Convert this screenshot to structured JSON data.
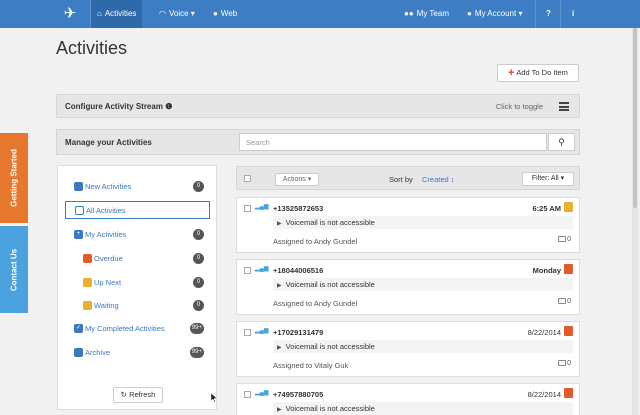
{
  "nav": {
    "activities": "Activities",
    "voice": "Voice",
    "web": "Web",
    "my_team": "My Team",
    "my_account": "My Account",
    "help": "?",
    "info": "i"
  },
  "side_tabs": {
    "getting_started": "Getting Started",
    "contact_us": "Contact Us"
  },
  "page": {
    "title": "Activities",
    "add_todo": "Add To Do Item",
    "configure_title": "Configure Activity Stream",
    "click_to_toggle": "Click to toggle",
    "manage_title": "Manage your Activities",
    "search_placeholder": "Search"
  },
  "filters": [
    {
      "label": "New Activities",
      "count": "0",
      "color": "#3a78c2"
    },
    {
      "label": "All Activities",
      "count": "",
      "color": "#3a78c2"
    },
    {
      "label": "My Activities",
      "count": "0",
      "color": "#3a78c2"
    },
    {
      "label": "Overdue",
      "count": "0",
      "color": "#e05a2a"
    },
    {
      "label": "Up Next",
      "count": "0",
      "color": "#e8b030"
    },
    {
      "label": "Waiting",
      "count": "0",
      "color": "#e8b030"
    },
    {
      "label": "My Completed Activities",
      "count": "99+",
      "color": "#3a78c2"
    },
    {
      "label": "Archive",
      "count": "99+",
      "color": "#3a78c2"
    }
  ],
  "refresh": "Refresh",
  "list": {
    "actions": "Actions",
    "sort_by": "Sort by",
    "sort_value": "Created",
    "filter": "Filter: All"
  },
  "activities": [
    {
      "phone": "+13525872653",
      "time": "6:25 AM",
      "message": "Voicemail is not accessible",
      "assigned": "Assigned to Andy Gundel",
      "comments": "0",
      "icon_color": "#e8b030",
      "bold_time": true
    },
    {
      "phone": "+18044006516",
      "time": "Monday",
      "message": "Voicemail is not accessible",
      "assigned": "Assigned to Andy Gundel",
      "comments": "0",
      "icon_color": "#e05a2a",
      "bold_time": true
    },
    {
      "phone": "+17029131479",
      "time": "8/22/2014",
      "message": "Voicemail is not accessible",
      "assigned": "Assigned to Vitaly Guk",
      "comments": "0",
      "icon_color": "#e05a2a",
      "bold_time": false
    },
    {
      "phone": "+74957880705",
      "time": "8/22/2014",
      "message": "Voicemail is not accessible",
      "assigned": "",
      "comments": "",
      "icon_color": "#e05a2a",
      "bold_time": false
    }
  ]
}
